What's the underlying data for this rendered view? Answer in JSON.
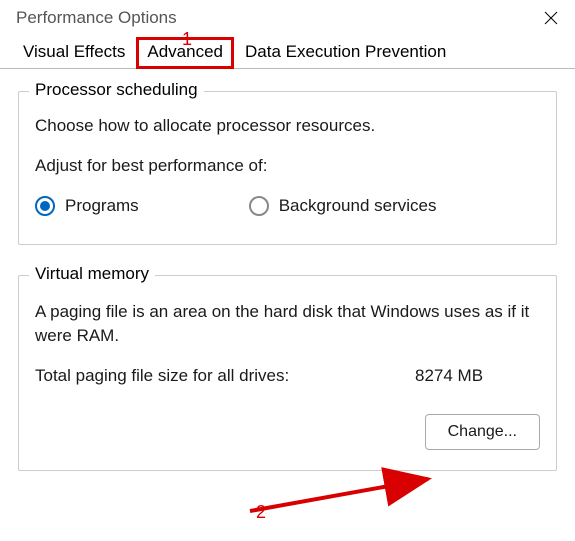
{
  "window": {
    "title": "Performance Options"
  },
  "annotations": {
    "callout1": "1",
    "callout2": "2",
    "highlight_tab_index": 1,
    "arrow_color": "#d80000"
  },
  "tabs": [
    {
      "label": "Visual Effects",
      "active": false
    },
    {
      "label": "Advanced",
      "active": true
    },
    {
      "label": "Data Execution Prevention",
      "active": false
    }
  ],
  "processor": {
    "group_title": "Processor scheduling",
    "description": "Choose how to allocate processor resources.",
    "adjust_label": "Adjust for best performance of:",
    "options": [
      {
        "label": "Programs",
        "selected": true
      },
      {
        "label": "Background services",
        "selected": false
      }
    ]
  },
  "virtual_memory": {
    "group_title": "Virtual memory",
    "description": "A paging file is an area on the hard disk that Windows uses as if it were RAM.",
    "total_label": "Total paging file size for all drives:",
    "total_value": "8274 MB",
    "change_button": "Change..."
  }
}
